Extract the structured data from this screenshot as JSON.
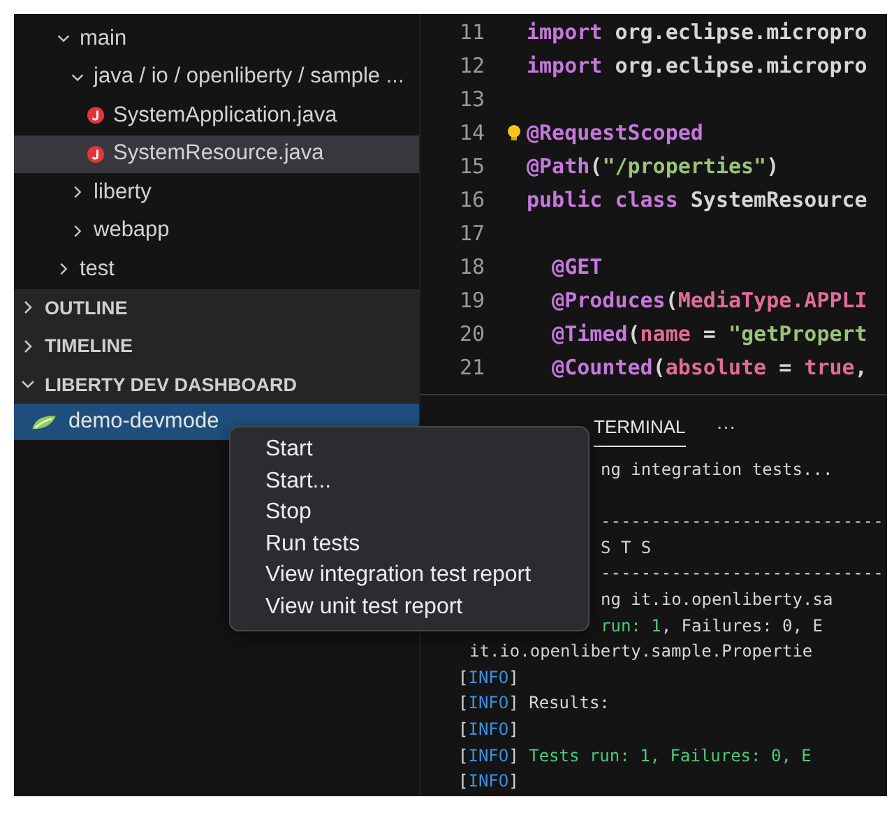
{
  "sidebar": {
    "tree": [
      {
        "label": "main",
        "kind": "folder",
        "expanded": true,
        "selected": false,
        "children": [
          {
            "label": "java / io / openliberty / sample ...",
            "kind": "folder",
            "expanded": true,
            "selected": false,
            "children": [
              {
                "label": "SystemApplication.java",
                "kind": "file",
                "selected": false
              },
              {
                "label": "SystemResource.java",
                "kind": "file",
                "selected": true
              }
            ]
          },
          {
            "label": "liberty",
            "kind": "folder",
            "expanded": false,
            "selected": false
          },
          {
            "label": "webapp",
            "kind": "folder",
            "expanded": false,
            "selected": false
          }
        ]
      },
      {
        "label": "test",
        "kind": "folder",
        "expanded": false,
        "selected": false
      }
    ],
    "sections": [
      {
        "title": "OUTLINE",
        "expanded": false
      },
      {
        "title": "TIMELINE",
        "expanded": false
      },
      {
        "title": "LIBERTY DEV DASHBOARD",
        "expanded": true,
        "items": [
          {
            "label": "demo-devmode",
            "selected": true
          }
        ]
      }
    ]
  },
  "editor": {
    "lines": [
      {
        "number": "11",
        "segments": [
          {
            "text": "import",
            "color": "#c678dd"
          },
          {
            "text": " org.eclipse.micropro",
            "color": "#d6d6d6"
          }
        ]
      },
      {
        "number": "12",
        "segments": [
          {
            "text": "import",
            "color": "#c678dd"
          },
          {
            "text": " org.eclipse.micropro",
            "color": "#d6d6d6"
          }
        ]
      },
      {
        "number": "13"
      },
      {
        "number": "14",
        "bulb": true,
        "segments": [
          {
            "text": "@RequestScoped",
            "color": "#c678dd"
          }
        ]
      },
      {
        "number": "15",
        "segments": [
          {
            "text": "@Path",
            "color": "#c678dd"
          },
          {
            "text": "(",
            "color": "#d6d6d6"
          },
          {
            "text": "\"/properties\"",
            "color": "#98c379"
          },
          {
            "text": ")",
            "color": "#d6d6d6"
          }
        ]
      },
      {
        "number": "16",
        "segments": [
          {
            "text": "public class",
            "color": "#c678dd"
          },
          {
            "text": " SystemResource",
            "color": "#d6d6d6"
          }
        ]
      },
      {
        "number": "17"
      },
      {
        "number": "18",
        "segments": [
          {
            "text": "  @GET",
            "color": "#c678dd"
          }
        ]
      },
      {
        "number": "19",
        "segments": [
          {
            "text": "  @Produces",
            "color": "#c678dd"
          },
          {
            "text": "(",
            "color": "#d6d6d6"
          },
          {
            "text": "MediaType.APPLI",
            "color": "#e06c9a"
          }
        ]
      },
      {
        "number": "20",
        "segments": [
          {
            "text": "  @Timed",
            "color": "#c678dd"
          },
          {
            "text": "(",
            "color": "#d6d6d6"
          },
          {
            "text": "name",
            "color": "#e06c9a"
          },
          {
            "text": " = ",
            "color": "#d6d6d6"
          },
          {
            "text": "\"getPropert",
            "color": "#98c379"
          }
        ]
      },
      {
        "number": "21",
        "segments": [
          {
            "text": "  @Counted",
            "color": "#c678dd"
          },
          {
            "text": "(",
            "color": "#d6d6d6"
          },
          {
            "text": "absolute",
            "color": "#e06c9a"
          },
          {
            "text": " = ",
            "color": "#d6d6d6"
          },
          {
            "text": "true",
            "color": "#e06c9a"
          },
          {
            "text": ",",
            "color": "#d6d6d6"
          }
        ]
      }
    ]
  },
  "panel": {
    "tabs": [
      {
        "label": "TERMINAL",
        "selected": true
      }
    ],
    "more": "···",
    "lines": [
      {
        "kind": "covered",
        "segments": [
          {
            "text": "ng integration tests...",
            "color": "#d6d6d6"
          }
        ]
      },
      {
        "kind": "blank"
      },
      {
        "kind": "covered",
        "segments": [
          {
            "text": "----------------------------",
            "color": "#d6d6d6"
          }
        ]
      },
      {
        "kind": "covered",
        "segments": [
          {
            "text": "S T S",
            "color": "#d6d6d6"
          }
        ]
      },
      {
        "kind": "covered",
        "segments": [
          {
            "text": "----------------------------",
            "color": "#d6d6d6"
          }
        ]
      },
      {
        "kind": "covered",
        "segments": [
          {
            "text": "ng it.io.openliberty.sa",
            "color": "#d6d6d6"
          }
        ]
      },
      {
        "kind": "covered",
        "segments": [
          {
            "text": "run: 1",
            "color": "#4ec97a"
          },
          {
            "text": ", Failures: 0, E",
            "color": "#d6d6d6"
          }
        ]
      },
      {
        "kind": "continuation",
        "segments": [
          {
            "text": "it.io.openliberty.sample.Propertie",
            "color": "#d6d6d6"
          }
        ]
      },
      {
        "kind": "full",
        "segments": [
          {
            "text": "[",
            "color": "#d6d6d6"
          },
          {
            "text": "INFO",
            "color": "#3d8fe0"
          },
          {
            "text": "]",
            "color": "#d6d6d6"
          }
        ]
      },
      {
        "kind": "full",
        "segments": [
          {
            "text": "[",
            "color": "#d6d6d6"
          },
          {
            "text": "INFO",
            "color": "#3d8fe0"
          },
          {
            "text": "] Results:",
            "color": "#d6d6d6"
          }
        ]
      },
      {
        "kind": "full",
        "segments": [
          {
            "text": "[",
            "color": "#d6d6d6"
          },
          {
            "text": "INFO",
            "color": "#3d8fe0"
          },
          {
            "text": "]",
            "color": "#d6d6d6"
          }
        ]
      },
      {
        "kind": "full",
        "segments": [
          {
            "text": "[",
            "color": "#d6d6d6"
          },
          {
            "text": "INFO",
            "color": "#3d8fe0"
          },
          {
            "text": "] ",
            "color": "#d6d6d6"
          },
          {
            "text": "Tests run: 1, Failures: 0, E",
            "color": "#4ec97a"
          }
        ]
      },
      {
        "kind": "full",
        "segments": [
          {
            "text": "[",
            "color": "#d6d6d6"
          },
          {
            "text": "INFO",
            "color": "#3d8fe0"
          },
          {
            "text": "]",
            "color": "#d6d6d6"
          }
        ]
      }
    ]
  },
  "context_menu": {
    "items": [
      "Start",
      "Start...",
      "Stop",
      "Run tests",
      "View integration test report",
      "View unit test report"
    ]
  }
}
